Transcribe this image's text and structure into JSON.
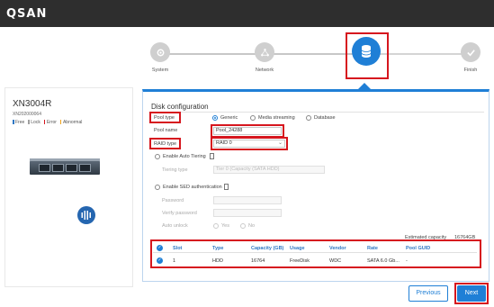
{
  "app": {
    "logo": "QSAN"
  },
  "wizard": {
    "steps": [
      {
        "label": "System",
        "icon": "gear-icon"
      },
      {
        "label": "Network",
        "icon": "network-icon"
      },
      {
        "label": "Storage",
        "icon": "database-icon"
      },
      {
        "label": "Finish",
        "icon": "check-icon"
      }
    ]
  },
  "device": {
    "model": "XN3004R",
    "serial": "XN202000064",
    "legend": [
      {
        "label": "Free",
        "color": "#2f78c4"
      },
      {
        "label": "Lock",
        "color": "#9e9e9e"
      },
      {
        "label": "Error",
        "color": "#d6161e"
      },
      {
        "label": "Abnormal",
        "color": "#f0a21a"
      }
    ]
  },
  "disk_config": {
    "title": "Disk configuration",
    "pool_type_label": "Pool type",
    "pool_type_options": [
      "Generic",
      "Media streaming",
      "Database"
    ],
    "pool_type_selected": "Generic",
    "pool_name_label": "Pool name",
    "pool_name_value": "Pool_24288",
    "raid_type_label": "RAID type",
    "raid_type_value": "RAID 0",
    "auto_tiering_label": "Enable Auto Tiering",
    "tiering_type_label": "Tiering type",
    "tiering_type_value": "Tier 0 (Capacity (SATA HDD)",
    "sed_label": "Enable SED authentication",
    "password_label": "Password",
    "verify_password_label": "Verify password",
    "auto_unlock_label": "Auto unlock",
    "auto_unlock_options": [
      "Yes",
      "No"
    ],
    "estimated_capacity_label": "Estimated capacity",
    "estimated_capacity_value": "16764GB"
  },
  "disk_table": {
    "columns": [
      "Slot",
      "Type",
      "Capacity (GB)",
      "Usage",
      "Vendor",
      "Rate",
      "Pool GUID"
    ],
    "rows": [
      {
        "slot": "1",
        "type": "HDD",
        "capacity": "16764",
        "usage": "FreeDisk",
        "vendor": "WDC",
        "rate": "SATA 6.0 Gb...",
        "pool_guid": "-"
      }
    ]
  },
  "buttons": {
    "previous": "Previous",
    "next": "Next"
  },
  "colors": {
    "accent": "#1f7fd6",
    "highlight": "#d6161e",
    "topbar": "#2e2e2e"
  }
}
